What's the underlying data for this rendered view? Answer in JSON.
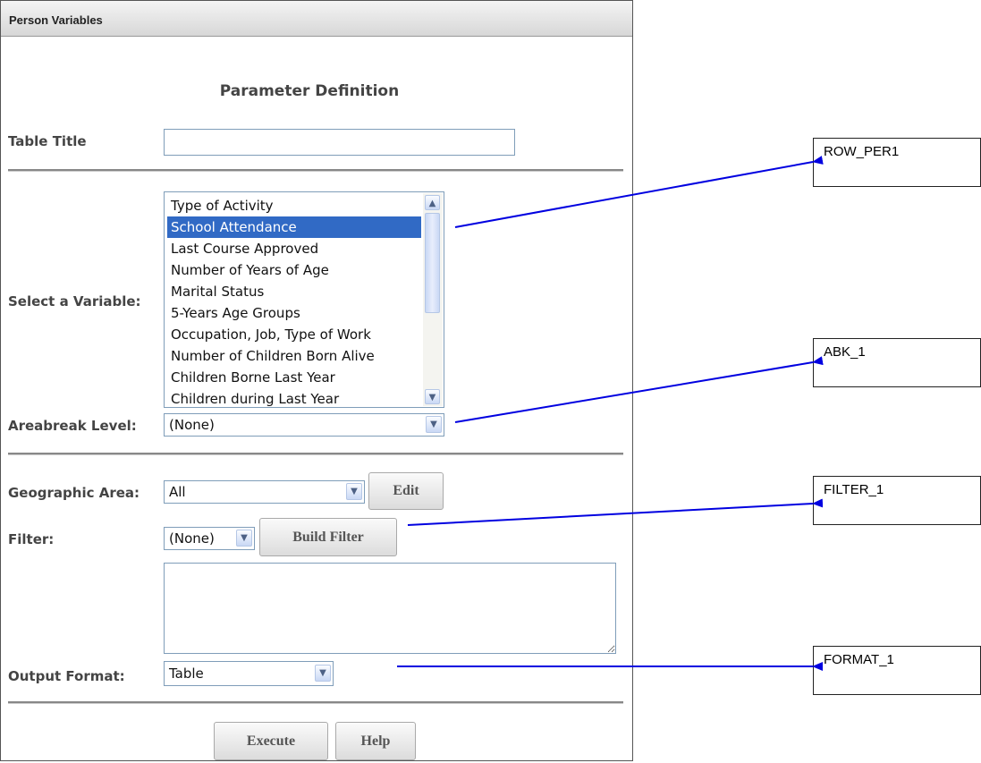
{
  "panel": {
    "title": "Person Variables",
    "heading": "Parameter Definition"
  },
  "form": {
    "table_title_label": "Table Title",
    "table_title_value": "",
    "select_variable_label": "Select a Variable:",
    "variables": [
      "Type of Activity",
      "School Attendance",
      "Last Course Approved",
      "Number of Years of Age",
      "Marital Status",
      "5-Years Age Groups",
      "Occupation, Job, Type of Work",
      "Number of Children Born Alive",
      "Children Borne Last Year",
      "Children during Last Year"
    ],
    "selected_variable": "School Attendance",
    "areabreak_label": "Areabreak Level:",
    "areabreak_value": "(None)",
    "geographic_label": "Geographic Area:",
    "geographic_value": "All",
    "edit_button": "Edit",
    "filter_label": "Filter:",
    "filter_value": "(None)",
    "build_filter_button": "Build Filter",
    "filter_text": "",
    "output_label": "Output Format:",
    "output_value": "Table",
    "execute_button": "Execute",
    "help_button": "Help"
  },
  "callouts": {
    "row": "ROW_PER1",
    "abk": "ABK_1",
    "filter": "FILTER_1",
    "format": "FORMAT_1"
  },
  "colors": {
    "selection": "#316ac5",
    "arrow": "#0000e0",
    "input_border": "#7f9db9"
  }
}
